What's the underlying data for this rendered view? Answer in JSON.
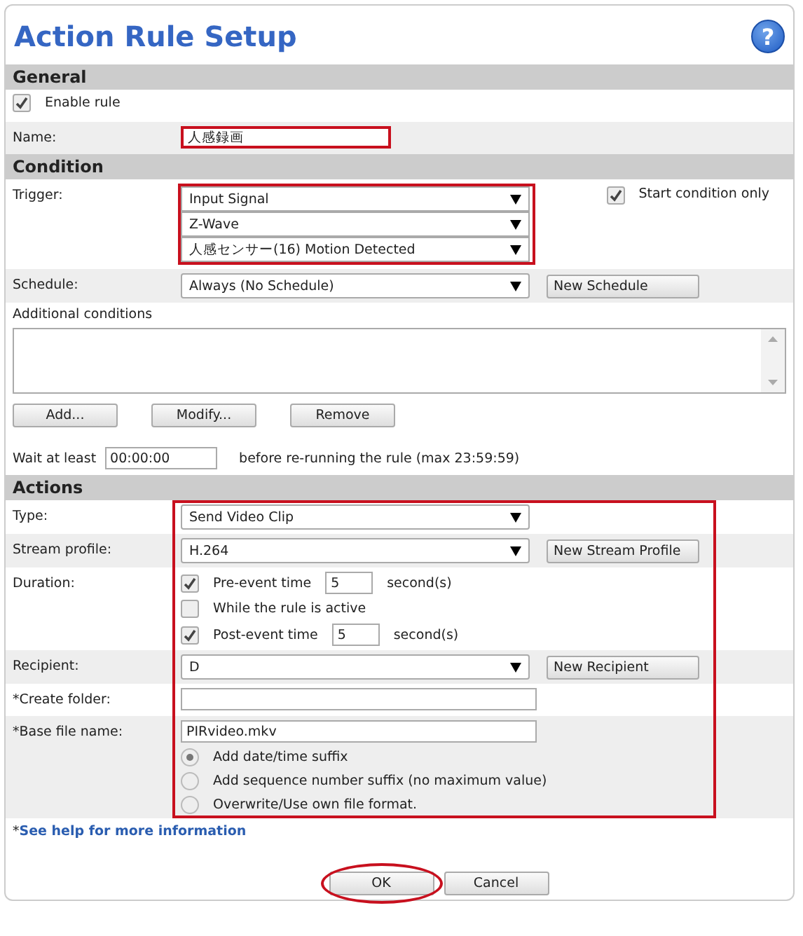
{
  "title": "Action Rule Setup",
  "help": "?",
  "sections": [
    {
      "title": "General",
      "highlighted": false,
      "rows": [
        {
          "kind": "checkbox",
          "label": "Enable rule",
          "checked": true
        },
        {
          "kind": "text",
          "label": "Name:",
          "value": "人感録画",
          "highlighted": true,
          "wide": false
        }
      ]
    },
    {
      "title": "Condition",
      "highlighted": false,
      "rows": [
        {
          "kind": "selects",
          "label": "Trigger:",
          "highlighted": true,
          "values": [
            "Input Signal",
            "Z-Wave",
            "人感センサー(16) Motion Detected"
          ],
          "side_checkbox": {
            "label": "Start condition only",
            "checked": true
          }
        },
        {
          "kind": "select",
          "label": "Schedule:",
          "value": "Always (No Schedule)",
          "button": "New Schedule"
        },
        {
          "kind": "conditions",
          "label": "Additional conditions",
          "buttons": [
            "Add...",
            "Modify...",
            "Remove"
          ],
          "wait_label": "Wait at least",
          "wait_value": "00:00:00",
          "wait_note": "before re-running the rule (max 23:59:59)"
        }
      ]
    },
    {
      "title": "Actions",
      "highlighted": true,
      "rows": [
        {
          "kind": "select",
          "label": "Type:",
          "value": "Send Video Clip"
        },
        {
          "kind": "select",
          "label": "Stream profile:",
          "value": "H.264",
          "button": "New Stream Profile"
        },
        {
          "kind": "duration",
          "label": "Duration:",
          "options": [
            {
              "label": "Pre-event time",
              "checked": true,
              "value": "5",
              "unit": "second(s)"
            },
            {
              "label": "While the rule is active",
              "checked": false
            },
            {
              "label": "Post-event time",
              "checked": true,
              "value": "5",
              "unit": "second(s)"
            }
          ]
        },
        {
          "kind": "select",
          "label": "Recipient:",
          "value": "D",
          "button": "New Recipient"
        },
        {
          "kind": "text",
          "label": "*Create folder:",
          "highlighted": false,
          "wide": true
        },
        {
          "kind": "text",
          "label": "*Base file name:",
          "value": "PIRvideo.mkv",
          "highlighted": false,
          "wide": true,
          "options": [
            {
              "label": "Add date/time suffix",
              "selected": true
            },
            {
              "label": "Add sequence number suffix (no maximum value)",
              "selected": false
            },
            {
              "label": "Overwrite/Use own file format.",
              "selected": false
            }
          ]
        }
      ]
    }
  ],
  "footnote_mark": "*",
  "help_link": "See help for more information",
  "buttons": [
    {
      "label": "OK",
      "highlighted": true
    },
    {
      "label": "Cancel",
      "highlighted": false
    }
  ]
}
